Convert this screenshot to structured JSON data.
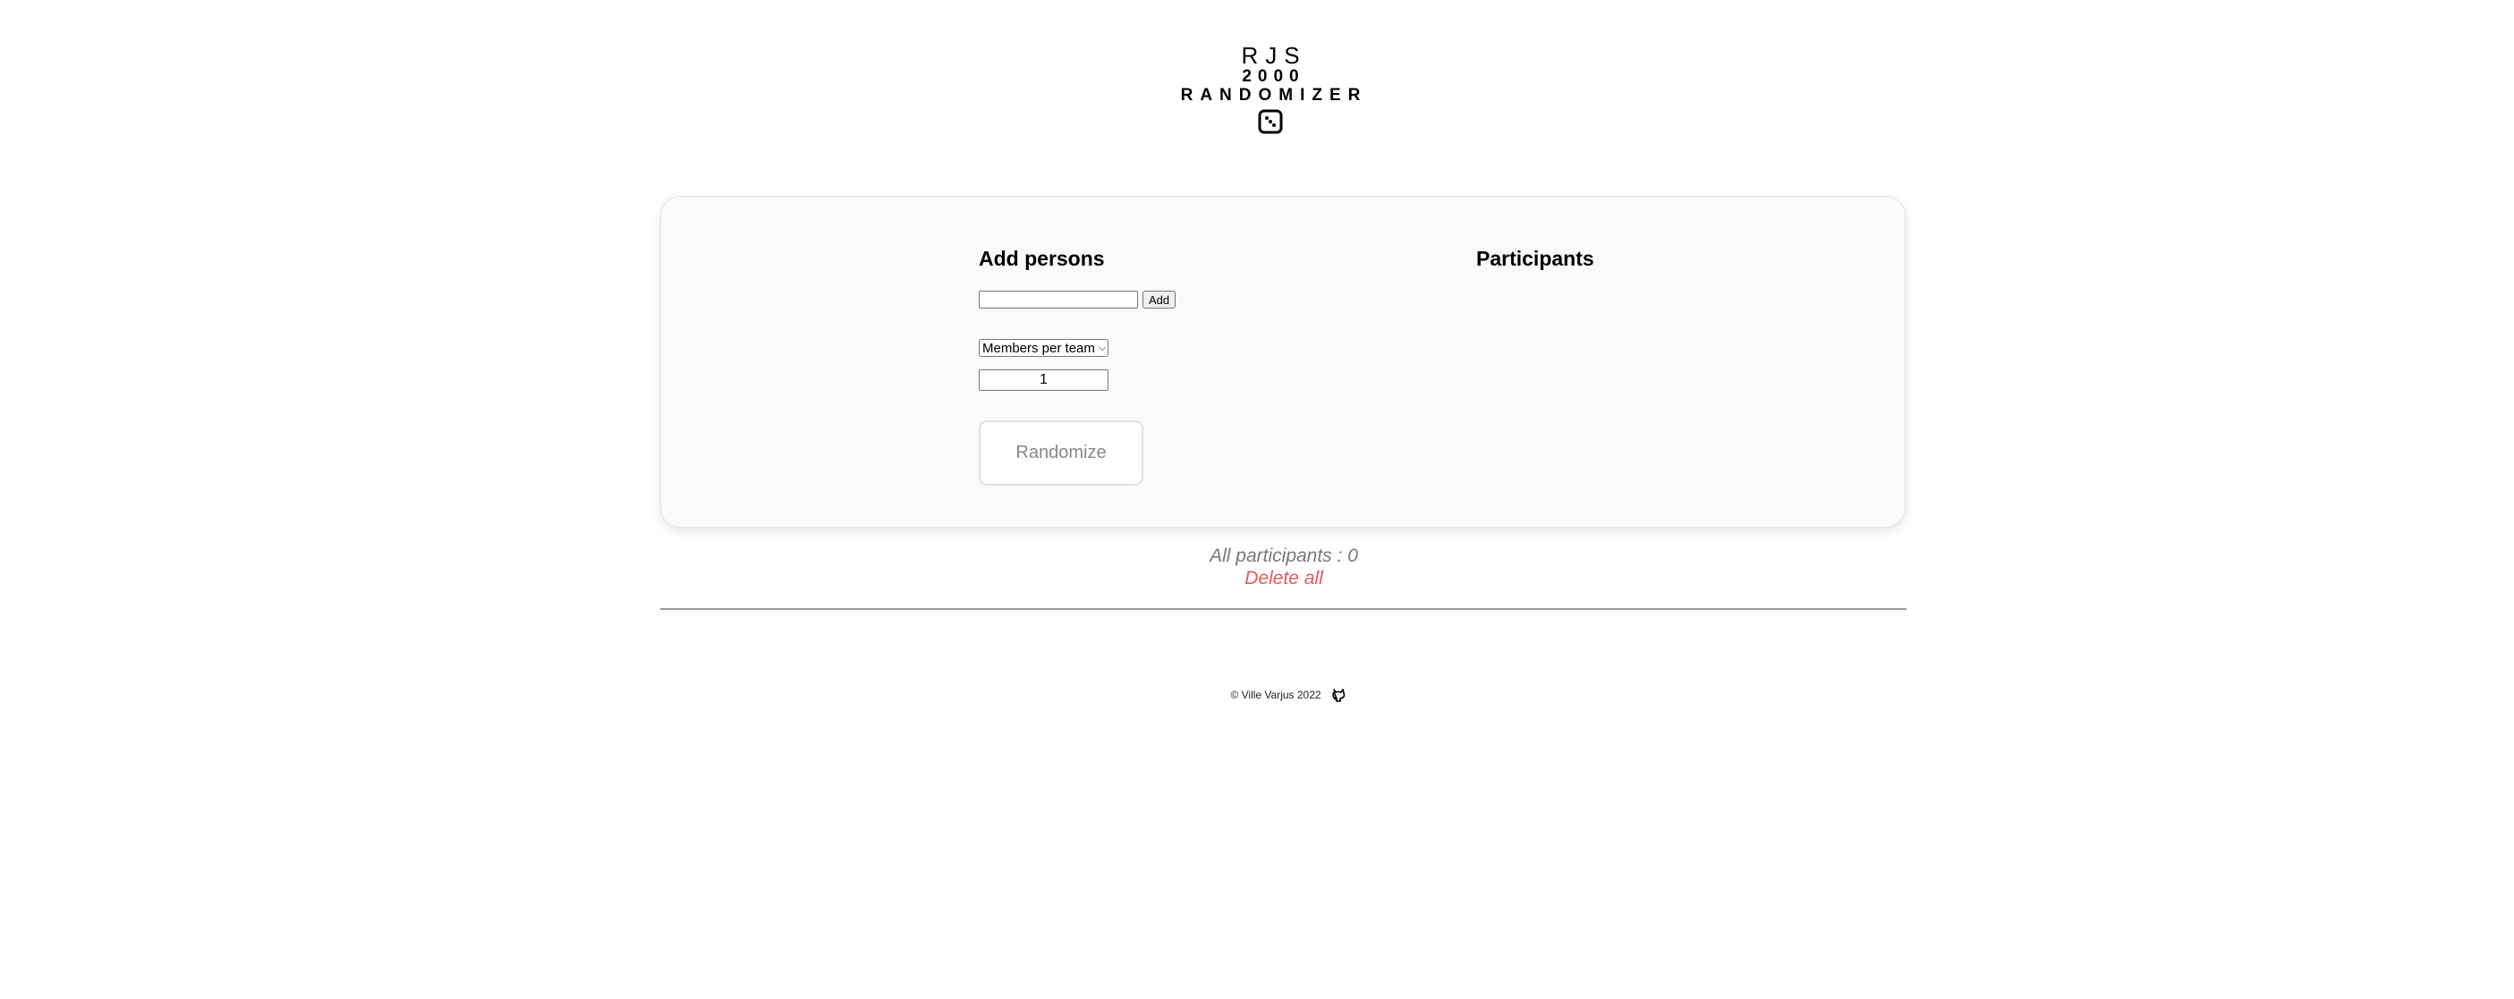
{
  "header": {
    "logo_line1": "RJS",
    "logo_line2": "2000",
    "logo_line3": "RANDOMIZER",
    "logo_icon": "dice-icon"
  },
  "add_section": {
    "heading": "Add persons",
    "name_input_value": "",
    "name_input_placeholder": "",
    "add_label": "Add",
    "team_select_value": "Members per team",
    "team_count_value": "1",
    "randomize_label": "Randomize"
  },
  "participants_section": {
    "heading": "Participants",
    "items": []
  },
  "summary": {
    "all_participants": "All participants : 0",
    "delete_all": "Delete all"
  },
  "footer": {
    "copyright": "© Ville Varjus 2022",
    "github_icon": "github-icon"
  },
  "colors": {
    "card_background": "#fafafa",
    "delete_color": "#e05a5f",
    "muted_text": "#777777"
  }
}
